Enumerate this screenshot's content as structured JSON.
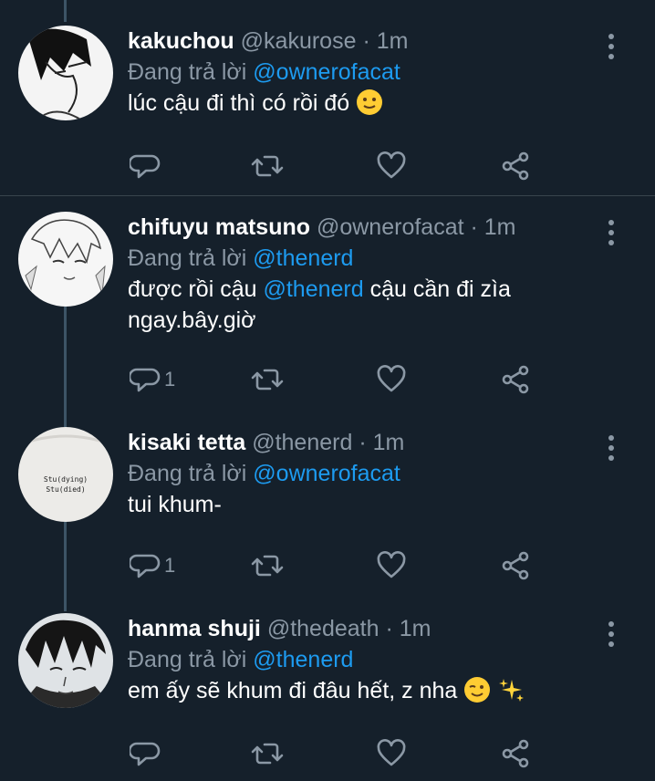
{
  "reply_prefix": "Đang trả lời",
  "tweets": [
    {
      "name": "kakuchou",
      "handle": "@kakurose",
      "sep": "·",
      "time": "1m",
      "reply_to": "@ownerofacat",
      "text": "lúc cậu đi thì có rồi đó",
      "reply_count": ""
    },
    {
      "name": "chifuyu matsuno",
      "handle": "@ownerofacat",
      "sep": "·",
      "time": "1m",
      "reply_to": "@thenerd",
      "text_pre": "được rồi cậu ",
      "text_mention": "@thenerd",
      "text_post": " cậu cần đi zìa ngay.bây.giờ",
      "reply_count": "1"
    },
    {
      "name": "kisaki tetta",
      "handle": "@thenerd",
      "sep": "·",
      "time": "1m",
      "reply_to": "@ownerofacat",
      "text": "tui khum-",
      "reply_count": "1",
      "avatar_text_1": "Stu(dying)",
      "avatar_text_2": "Stu(died)"
    },
    {
      "name": "hanma shuji",
      "handle": "@thedeath",
      "sep": "·",
      "time": "1m",
      "reply_to": "@thenerd",
      "text": "em ấy sẽ khum đi đâu hết, z nha",
      "reply_count": ""
    }
  ],
  "colors": {
    "background": "#15202b",
    "secondary_text": "#8b98a5",
    "mention": "#1d9bf0",
    "thread_line": "#3d5466"
  },
  "icons": [
    "reply-icon",
    "retweet-icon",
    "like-icon",
    "share-icon",
    "more-icon"
  ]
}
